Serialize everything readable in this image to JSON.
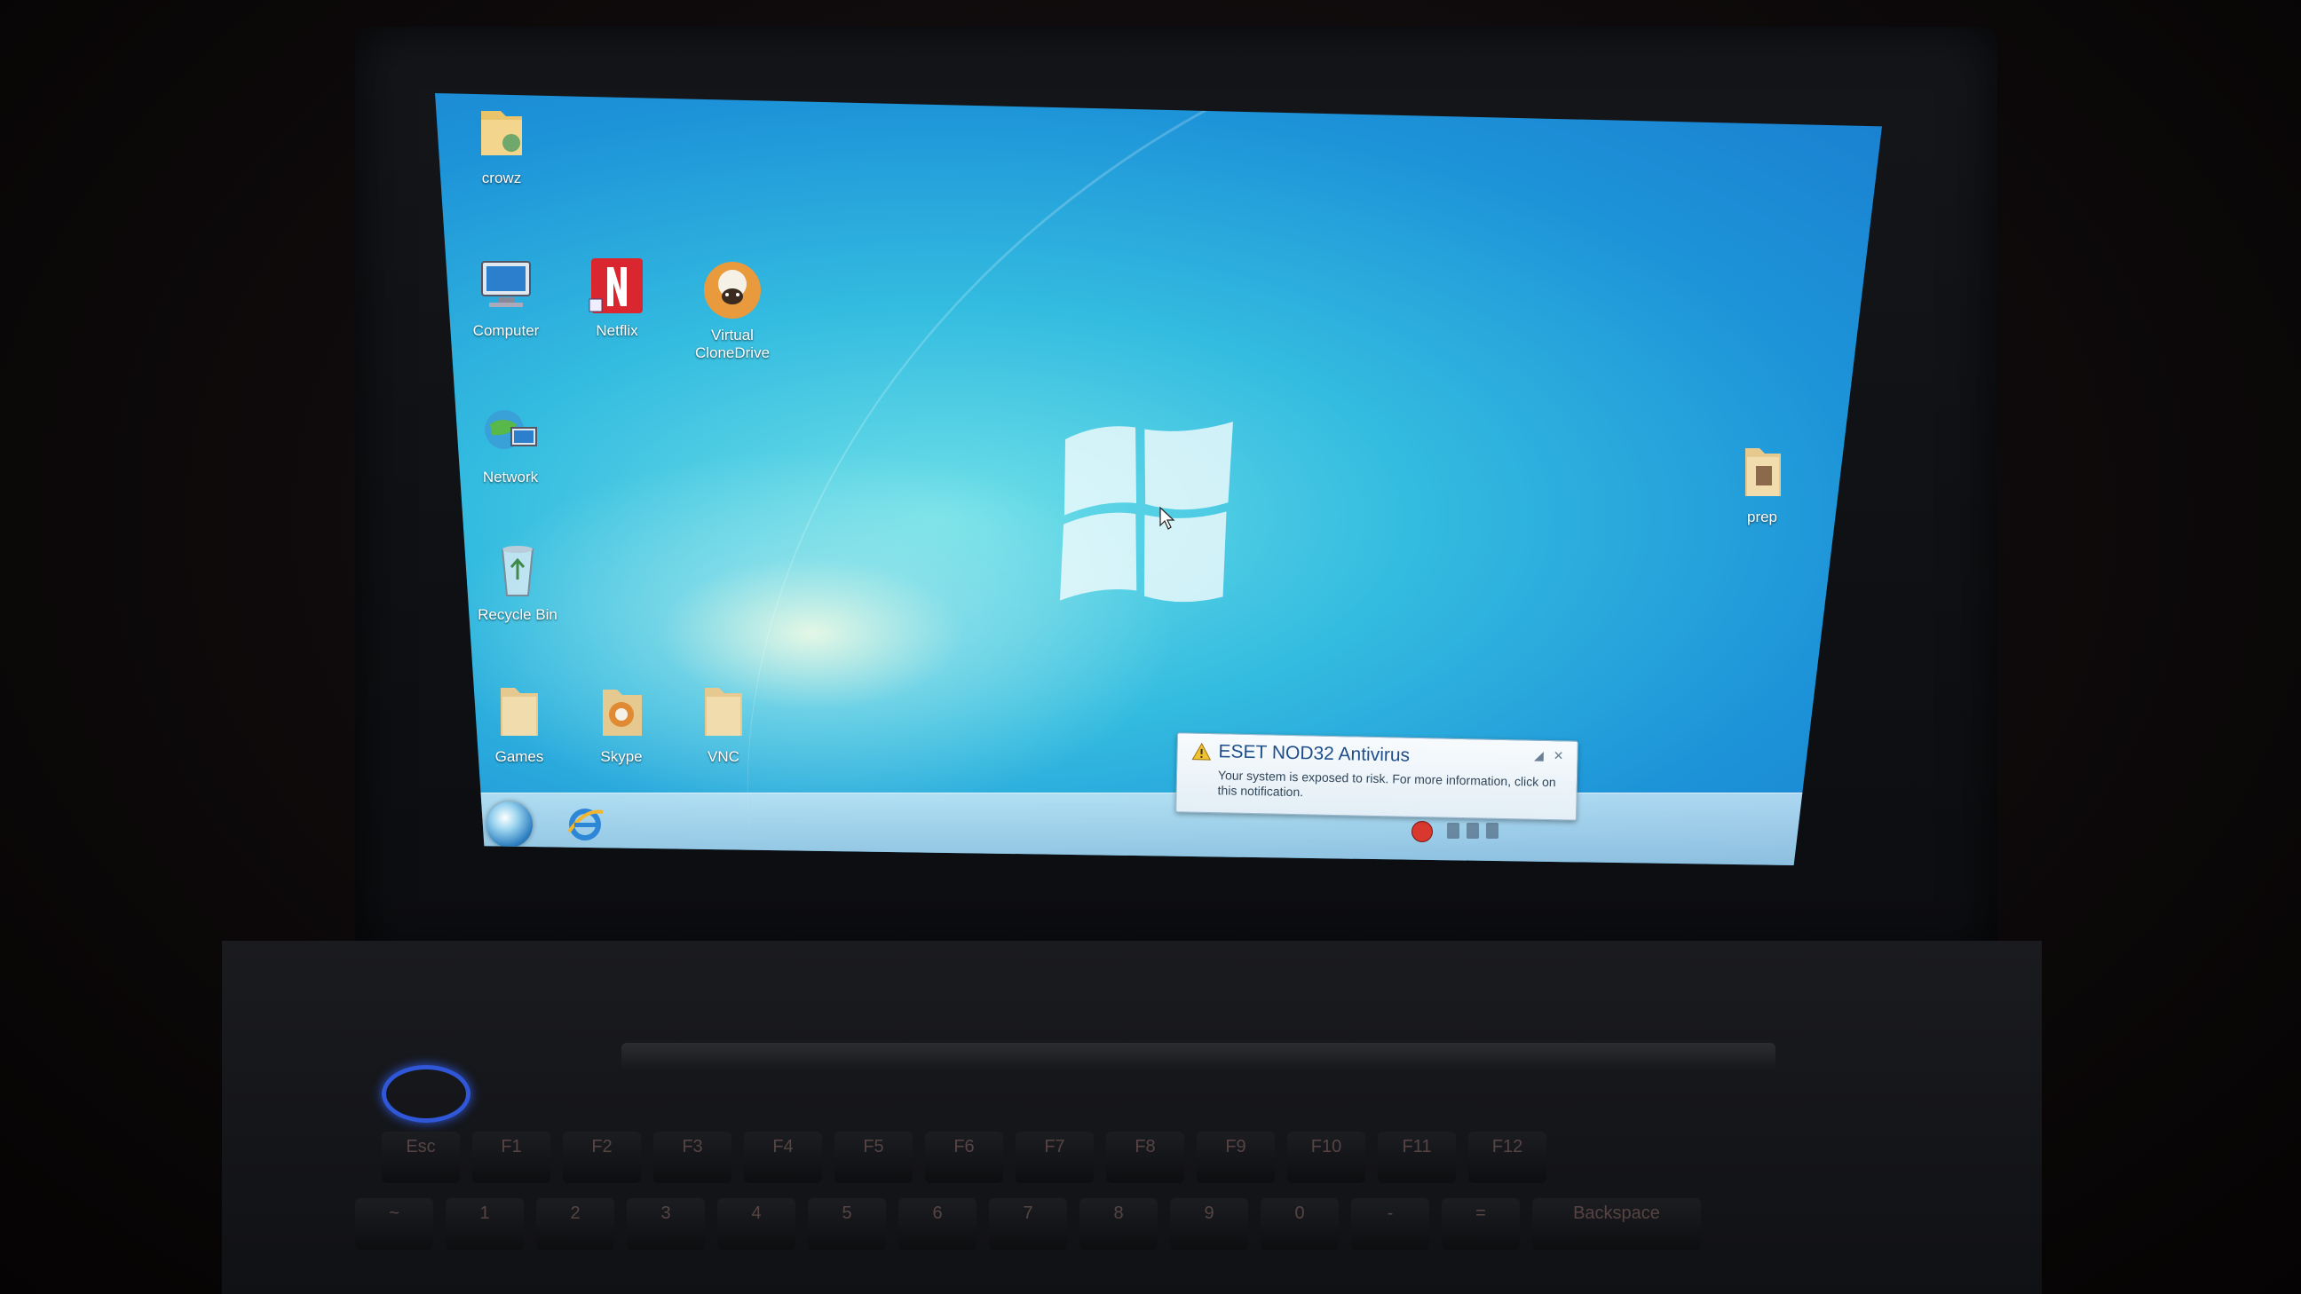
{
  "desktop": {
    "icons": [
      {
        "label": "crowz",
        "icon": "folder-icon"
      },
      {
        "label": "Computer",
        "icon": "computer-icon"
      },
      {
        "label": "Netflix",
        "icon": "netflix-icon"
      },
      {
        "label": "Virtual CloneDrive",
        "icon": "clonedrive-sheep-icon"
      },
      {
        "label": "Network",
        "icon": "network-icon"
      },
      {
        "label": "Recycle Bin",
        "icon": "recycle-bin-icon"
      },
      {
        "label": "Games",
        "icon": "folder-icon"
      },
      {
        "label": "Skype",
        "icon": "skype-icon"
      },
      {
        "label": "VNC",
        "icon": "folder-icon"
      },
      {
        "label": "prep",
        "icon": "folder-icon"
      }
    ]
  },
  "notification": {
    "title": "ESET NOD32 Antivirus",
    "body": "Your system is exposed to risk. For more information, click on this notification.",
    "icon": "warning-icon"
  },
  "taskbar": {
    "start": "start-orb-icon",
    "pinned": [
      "internet-explorer-icon"
    ]
  },
  "keyboard": {
    "fn_row": [
      "Esc",
      "F1",
      "F2",
      "F3",
      "F4",
      "F5",
      "F6",
      "F7",
      "F8",
      "F9",
      "F10",
      "F11",
      "F12"
    ],
    "num_row": [
      "~",
      "1",
      "2",
      "3",
      "4",
      "5",
      "6",
      "7",
      "8",
      "9",
      "0",
      "-",
      "=",
      "Backspace"
    ]
  },
  "colors": {
    "desktop": "#1d93d8",
    "taskbar": "#b7d6ea",
    "alert": "#d8382d",
    "led": "#2f57d8"
  }
}
